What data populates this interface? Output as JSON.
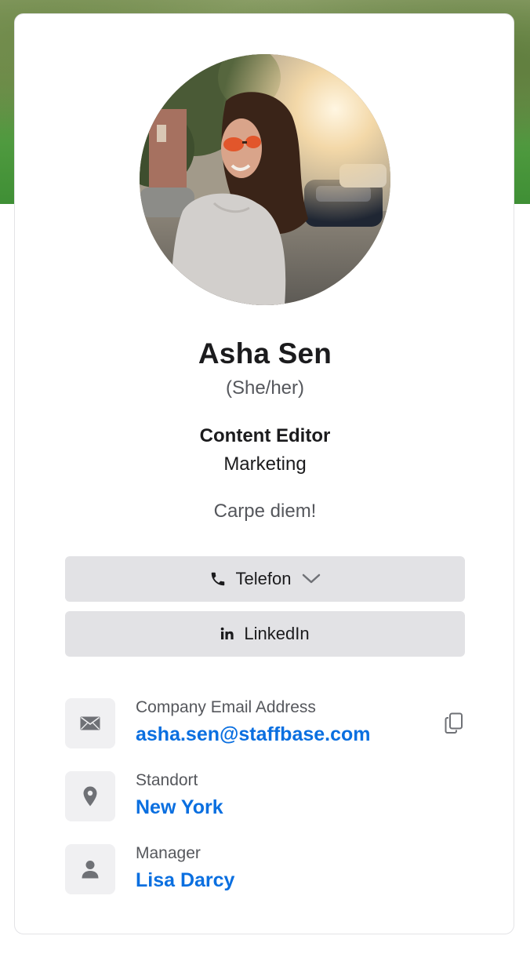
{
  "profile": {
    "name": "Asha Sen",
    "pronouns": "(She/her)",
    "job_title": "Content Editor",
    "department": "Marketing",
    "status": "Carpe diem!"
  },
  "actions": {
    "phone_label": "Telefon",
    "linkedin_label": "LinkedIn",
    "phone_icon": "phone-icon",
    "linkedin_icon": "linkedin-icon",
    "dropdown_icon": "chevron-down-icon"
  },
  "details": {
    "email": {
      "label": "Company Email Address",
      "value": "asha.sen@staffbase.com",
      "icon": "envelope-icon",
      "copy_icon": "copy-icon"
    },
    "location": {
      "label": "Standort",
      "value": "New York",
      "icon": "location-pin-icon"
    },
    "manager": {
      "label": "Manager",
      "value": "Lisa Darcy",
      "icon": "person-icon"
    }
  },
  "colors": {
    "accent_link": "#0a6fe0",
    "button_bg": "#e2e2e5",
    "tile_bg": "#f0f0f2",
    "text_primary": "#1b1b1d",
    "text_secondary": "#55575c"
  }
}
